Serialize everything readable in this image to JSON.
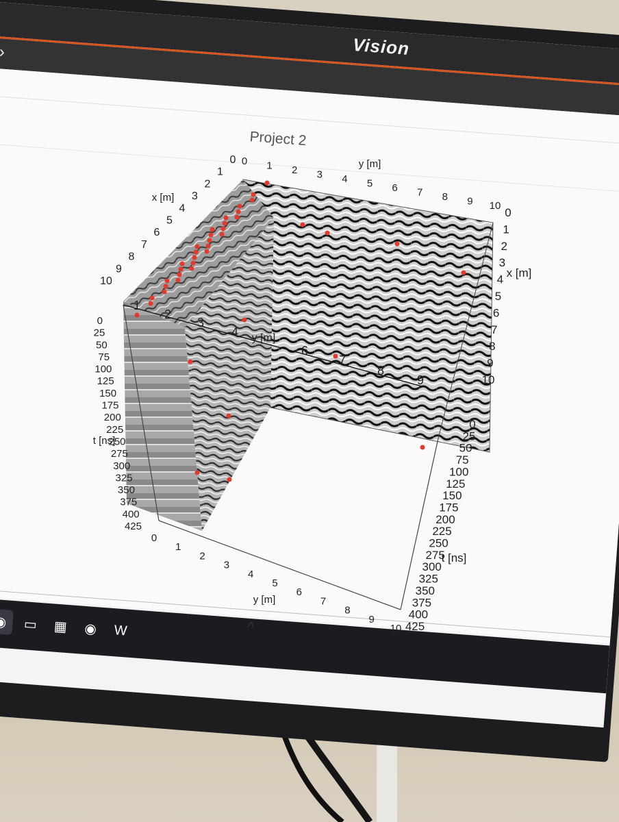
{
  "app": {
    "title": "Vision"
  },
  "navbar": {
    "expand_icon": "chevron-right-icon"
  },
  "project": {
    "title": "Project 2"
  },
  "chart_data": {
    "type": "3d-volume-slices",
    "axes": {
      "x": {
        "label": "x [m]",
        "ticks": [
          "0",
          "1",
          "2",
          "3",
          "4",
          "5",
          "6",
          "7",
          "8",
          "9",
          "10"
        ]
      },
      "y": {
        "label": "y [m]",
        "ticks": [
          "0",
          "1",
          "2",
          "3",
          "4",
          "5",
          "6",
          "7",
          "8",
          "9",
          "10"
        ]
      },
      "t": {
        "label": "t [ns]",
        "ticks": [
          "0",
          "25",
          "50",
          "75",
          "100",
          "125",
          "150",
          "175",
          "200",
          "225",
          "250",
          "275",
          "300",
          "325",
          "350",
          "375",
          "400",
          "425"
        ]
      }
    },
    "inner_y_labels": [
      "1",
      "2",
      "3",
      "4",
      "6",
      "7",
      "8",
      "9"
    ],
    "inner_y_label": "y [m]",
    "marker_color": "#e23b2e"
  },
  "taskbar": {
    "items": [
      {
        "name": "edge-icon",
        "glyph": "◐"
      },
      {
        "name": "chrome-icon",
        "glyph": "◉"
      },
      {
        "name": "file-explorer-icon",
        "glyph": "▭"
      },
      {
        "name": "calendar-icon",
        "glyph": "▦"
      },
      {
        "name": "chrome-icon",
        "glyph": "◉"
      },
      {
        "name": "word-icon",
        "glyph": "W"
      }
    ],
    "collapse_icon": "chevron-up-icon"
  }
}
